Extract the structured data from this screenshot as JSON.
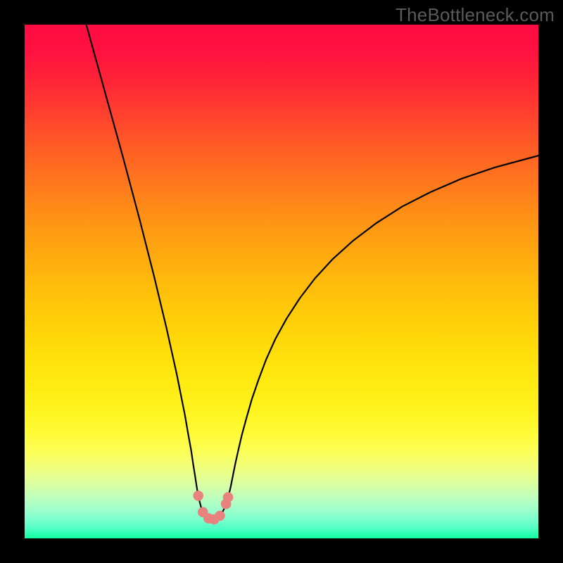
{
  "watermark": "TheBottleneck.com",
  "chart_data": {
    "type": "line",
    "title": "",
    "xlabel": "",
    "ylabel": "",
    "xlim": [
      0,
      1000
    ],
    "ylim": [
      0,
      1000
    ],
    "gradient_stops": [
      {
        "offset": 0.0,
        "color": "#ff0b42"
      },
      {
        "offset": 0.05,
        "color": "#ff1140"
      },
      {
        "offset": 0.1,
        "color": "#ff2139"
      },
      {
        "offset": 0.15,
        "color": "#ff3632"
      },
      {
        "offset": 0.2,
        "color": "#ff4c2b"
      },
      {
        "offset": 0.25,
        "color": "#ff6124"
      },
      {
        "offset": 0.3,
        "color": "#ff751e"
      },
      {
        "offset": 0.35,
        "color": "#ff8818"
      },
      {
        "offset": 0.4,
        "color": "#ff9a13"
      },
      {
        "offset": 0.45,
        "color": "#ffaa0f"
      },
      {
        "offset": 0.5,
        "color": "#ffba0c"
      },
      {
        "offset": 0.55,
        "color": "#ffc80a"
      },
      {
        "offset": 0.6,
        "color": "#ffd509"
      },
      {
        "offset": 0.65,
        "color": "#ffe10b"
      },
      {
        "offset": 0.7,
        "color": "#ffeb12"
      },
      {
        "offset": 0.75,
        "color": "#fff41f"
      },
      {
        "offset": 0.795,
        "color": "#fffb37"
      },
      {
        "offset": 0.83,
        "color": "#fcff56"
      },
      {
        "offset": 0.86,
        "color": "#f2ff7a"
      },
      {
        "offset": 0.89,
        "color": "#deff9d"
      },
      {
        "offset": 0.92,
        "color": "#bfffbd"
      },
      {
        "offset": 0.945,
        "color": "#9cffcc"
      },
      {
        "offset": 0.965,
        "color": "#78ffce"
      },
      {
        "offset": 0.98,
        "color": "#52ffc5"
      },
      {
        "offset": 0.99,
        "color": "#30ffb4"
      },
      {
        "offset": 1.0,
        "color": "#10ff9d"
      }
    ],
    "series": [
      {
        "name": "curve",
        "style": "black-thin",
        "points": [
          [
            120,
            1000
          ],
          [
            138,
            935
          ],
          [
            156,
            870
          ],
          [
            174,
            805
          ],
          [
            192,
            740
          ],
          [
            208,
            680
          ],
          [
            224,
            620
          ],
          [
            238,
            565
          ],
          [
            252,
            510
          ],
          [
            264,
            460
          ],
          [
            276,
            410
          ],
          [
            286,
            365
          ],
          [
            296,
            320
          ],
          [
            304,
            280
          ],
          [
            312,
            240
          ],
          [
            318,
            205
          ],
          [
            324,
            172
          ],
          [
            328,
            145
          ],
          [
            332,
            120
          ],
          [
            335,
            100
          ],
          [
            338,
            83
          ],
          [
            341,
            70
          ],
          [
            344,
            59
          ],
          [
            347,
            51
          ],
          [
            350,
            46
          ],
          [
            353,
            42
          ],
          [
            357,
            39
          ],
          [
            361,
            37
          ],
          [
            365,
            36.5
          ],
          [
            369,
            37
          ],
          [
            373,
            39
          ],
          [
            377,
            42
          ],
          [
            381,
            46
          ],
          [
            385,
            51
          ],
          [
            389,
            59
          ],
          [
            393,
            70
          ],
          [
            397,
            83
          ],
          [
            401,
            100
          ],
          [
            405,
            120
          ],
          [
            410,
            145
          ],
          [
            416,
            172
          ],
          [
            423,
            202
          ],
          [
            432,
            235
          ],
          [
            442,
            270
          ],
          [
            455,
            308
          ],
          [
            470,
            348
          ],
          [
            488,
            388
          ],
          [
            510,
            428
          ],
          [
            536,
            468
          ],
          [
            565,
            506
          ],
          [
            600,
            544
          ],
          [
            640,
            580
          ],
          [
            685,
            614
          ],
          [
            735,
            646
          ],
          [
            790,
            674
          ],
          [
            850,
            700
          ],
          [
            915,
            722
          ],
          [
            1000,
            745
          ]
        ]
      },
      {
        "name": "markers",
        "style": "red-dots",
        "points": [
          [
            338,
            83
          ],
          [
            347,
            51
          ],
          [
            358,
            39
          ],
          [
            369,
            37
          ],
          [
            380,
            44
          ],
          [
            392,
            67
          ],
          [
            396,
            80
          ]
        ]
      }
    ]
  }
}
